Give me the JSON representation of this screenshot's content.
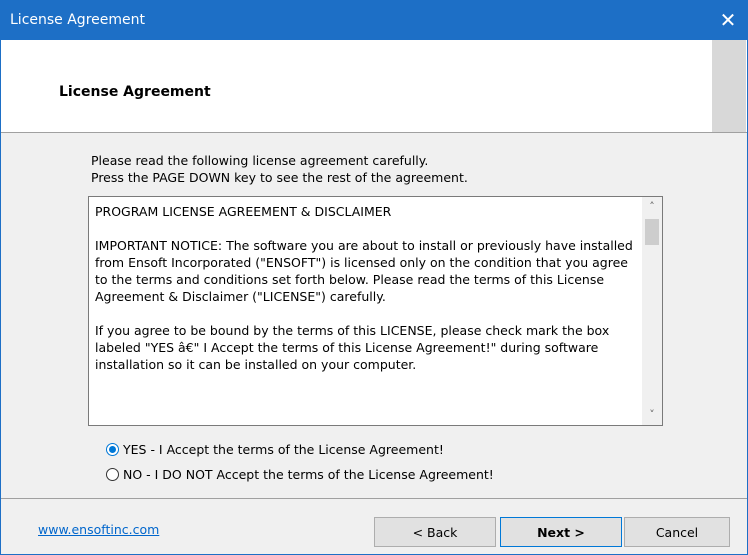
{
  "window": {
    "title": "License Agreement"
  },
  "header": {
    "title": "License Agreement"
  },
  "instructions": {
    "line1": "Please read the following license agreement carefully.",
    "line2": "Press the PAGE DOWN key to see the rest of the agreement."
  },
  "license": {
    "paragraphs": [
      "PROGRAM LICENSE AGREEMENT & DISCLAIMER",
      "IMPORTANT NOTICE:  The software you are about to install or previously have installed from Ensoft Incorporated (\"ENSOFT\") is licensed only on the condition that you agree to the terms and conditions set forth below. Please read the terms of this License Agreement & Disclaimer (\"LICENSE\") carefully.",
      "If you agree to be bound by the terms of this LICENSE, please check mark the box labeled \"YES â€\" I Accept the terms of this License Agreement!\" during software installation so it can be installed on your computer."
    ]
  },
  "options": {
    "accept": "YES - I Accept the terms of the License Agreement!",
    "decline": "NO - I DO NOT Accept the terms of the License Agreement!",
    "selected": "accept"
  },
  "footer": {
    "link": "www.ensoftinc.com",
    "back": "< Back",
    "next": "Next >",
    "cancel": "Cancel"
  }
}
